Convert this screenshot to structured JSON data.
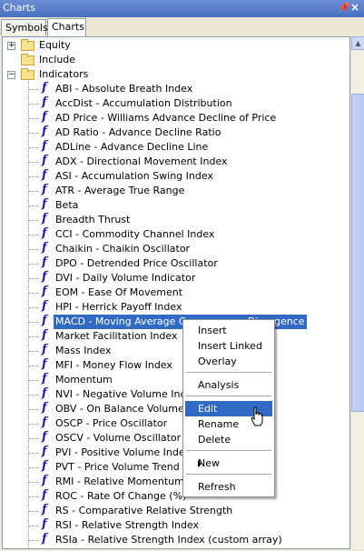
{
  "window": {
    "title": "Charts"
  },
  "tabs": [
    "Symbols",
    "Charts"
  ],
  "tree": {
    "folders": [
      {
        "label": "Equity",
        "expanded": false
      },
      {
        "label": "Include",
        "expanded": null
      },
      {
        "label": "Indicators",
        "expanded": true
      }
    ],
    "indicators": [
      "ABI - Absolute Breath Index",
      "AccDist - Accumulation Distribution",
      "AD Price - Williams Advance Decline of Price",
      "AD Ratio - Advance Decline Ratio",
      "ADLine - Advance Decline Line",
      "ADX - Directional Movement Index",
      "ASI - Accumulation Swing Index",
      "ATR - Average True Range",
      "Beta",
      "Breadth Thrust",
      "CCI - Commodity Channel Index",
      "Chaikin - Chaikin Oscillator",
      "DPO - Detrended Price Oscillator",
      "DVI - Daily Volume Indicator",
      "EOM - Ease Of Movement",
      "HPI - Herrick Payoff Index",
      "MACD - Moving Average Convergence Divergence",
      "Market Facilitation Index",
      "Mass Index",
      "MFI - Money Flow Index",
      "Momentum",
      "NVI - Negative Volume Index",
      "OBV - On Balance Volume",
      "OSCP - Price Oscillator",
      "OSCV - Volume Oscillator",
      "PVI - Positive Volume Index",
      "PVT - Price Volume Trend",
      "RMI - Relative Momentum Index",
      "ROC - Rate Of Change (%)",
      "RS - Comparative Relative Strength",
      "RSI - Relative Strength Index",
      "RSIa - Relative Strength Index (custom array)"
    ],
    "selected_index": 16
  },
  "context_menu": {
    "items": [
      "Insert",
      "Insert Linked",
      "Overlay",
      "Analysis",
      "Edit",
      "Rename",
      "Delete",
      "New",
      "Refresh"
    ],
    "highlighted": "Edit"
  },
  "icons": {
    "pin": "pin-icon",
    "close": "close-icon",
    "function": "function-icon",
    "folder": "folder-icon"
  },
  "colors": {
    "selection": "#316ac5",
    "function_icon": "#1a1ab0",
    "title_bar": "#4a6fc0"
  }
}
